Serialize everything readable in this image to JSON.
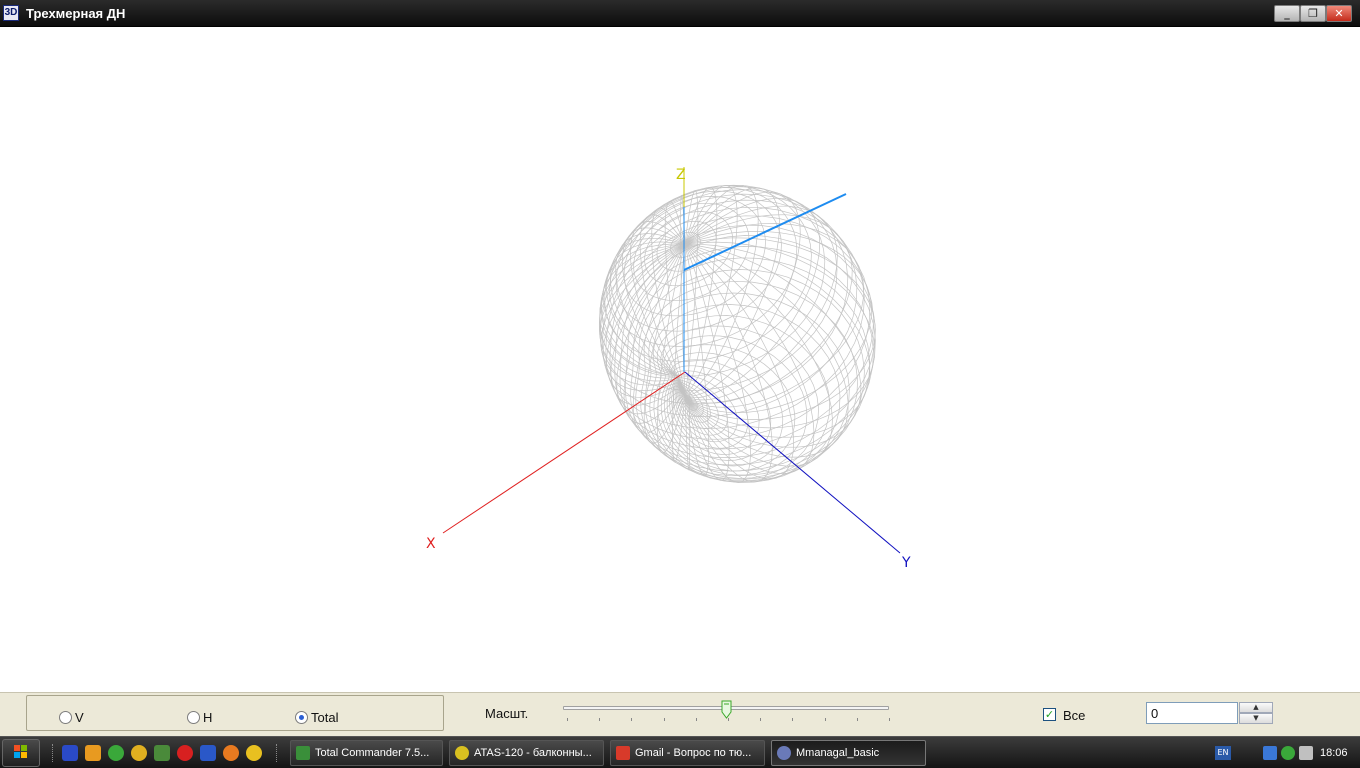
{
  "window": {
    "icon_text": "3D",
    "title": "Трехмерная ДН",
    "minimize_glyph": "_",
    "restore_glyph": "❐",
    "close_glyph": "✕"
  },
  "plot": {
    "axis_x_label": "X",
    "axis_y_label": "Y",
    "axis_z_label": "Z",
    "axis_x_color": "#e02020",
    "axis_y_color": "#1010c0",
    "axis_z_color": "#c8c800",
    "wire_color": "#c4c4c4",
    "beam_color": "#1e8cf0"
  },
  "controls": {
    "radio_v_label": "V",
    "radio_h_label": "H",
    "radio_total_label": "Total",
    "selected": "Total",
    "scale_label": "Масшт.",
    "scale_value": 0.5,
    "all_label": "Все",
    "all_checked": true,
    "value": "0"
  },
  "taskbar": {
    "tasks": [
      {
        "label": "Total Commander 7.5...",
        "icon": "floppy-icon",
        "color": "#3a8f3a"
      },
      {
        "label": "ATAS-120 - балконны...",
        "icon": "chrome-icon",
        "color": "#d8c020"
      },
      {
        "label": "Gmail - Вопрос по тю...",
        "icon": "gmail-icon",
        "color": "#d83a2a"
      },
      {
        "label": "Mmanagal_basic",
        "icon": "mmana-icon",
        "color": "#6a7ab8"
      }
    ],
    "lang": "EN",
    "clock": "18:06"
  }
}
